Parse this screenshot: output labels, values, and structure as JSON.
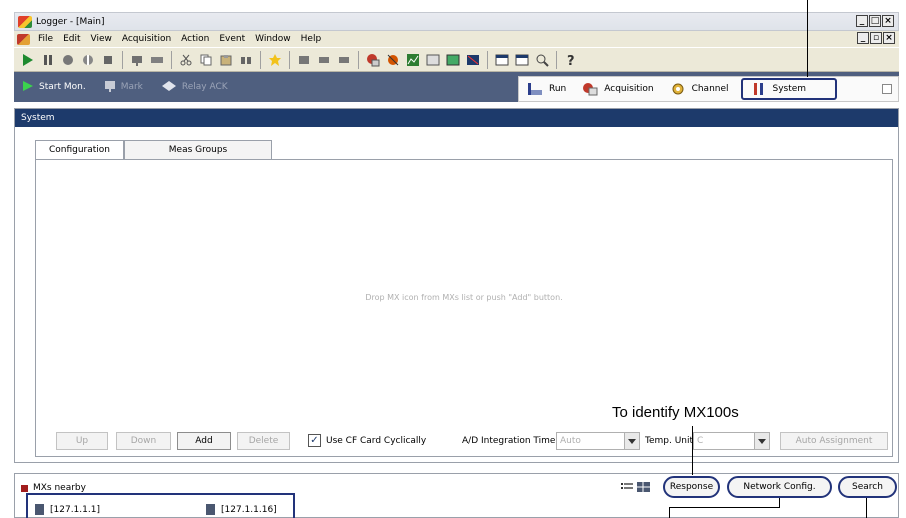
{
  "window": {
    "title": "Logger - [Main]"
  },
  "menu": {
    "items": [
      "File",
      "Edit",
      "View",
      "Acquisition",
      "Action",
      "Event",
      "Window",
      "Help"
    ]
  },
  "actionbar": {
    "start_mon": "Start Mon.",
    "mark": "Mark",
    "relay_ack": "Relay ACK"
  },
  "viewtabs": {
    "run": "Run",
    "acquisition": "Acquisition",
    "channel": "Channel",
    "system": "System"
  },
  "panel": {
    "title": "System",
    "tabs": {
      "configuration": "Configuration",
      "meas_groups": "Meas Groups"
    },
    "empty_message": "Drop MX icon from MXs list or push \"Add\" button.",
    "buttons": {
      "up": "Up",
      "down": "Down",
      "add": "Add",
      "delete": "Delete",
      "auto_assignment": "Auto Assignment"
    },
    "use_cf_card": {
      "label": "Use CF Card Cyclically",
      "checked": true
    },
    "ad_integration": {
      "label": "A/D Integration Time",
      "value": "Auto"
    },
    "temp_unit": {
      "label": "Temp. Unit",
      "value": "C"
    }
  },
  "nearby": {
    "title": "MXs nearby",
    "buttons": {
      "response": "Response",
      "network_config": "Network Config.",
      "search": "Search"
    },
    "items": [
      "[127.1.1.1]",
      "[127.1.1.16]"
    ]
  },
  "annotation": {
    "identify": "To identify MX100s"
  },
  "colors": {
    "panel_header": "#1d3a6b",
    "actionbar": "#4f5f7f",
    "highlight": "#22337a"
  }
}
